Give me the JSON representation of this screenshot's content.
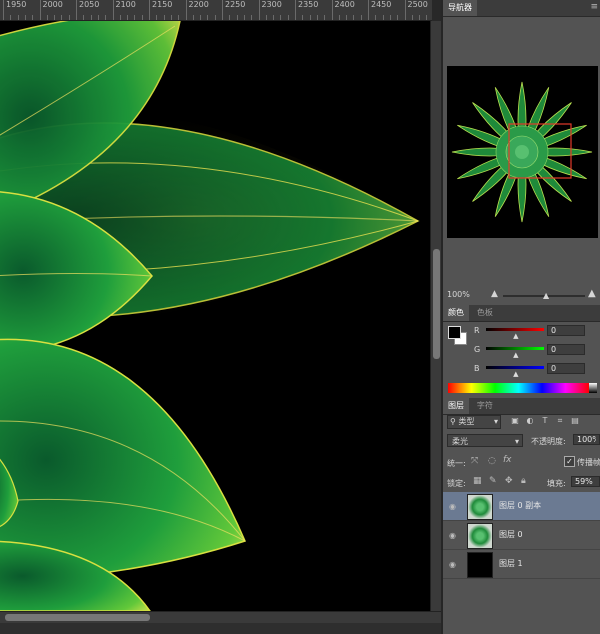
{
  "ruler": {
    "ticks": [
      "1950",
      "2000",
      "2050",
      "2100",
      "2150",
      "2200",
      "2250",
      "2300",
      "2350",
      "2400",
      "2450",
      "2500"
    ]
  },
  "navigator": {
    "tab": "导航器",
    "zoom": "100%"
  },
  "color": {
    "tabs": [
      "颜色",
      "色板"
    ],
    "r_label": "R",
    "g_label": "G",
    "b_label": "B",
    "r_value": "0",
    "g_value": "0",
    "b_value": "0",
    "r_level": 0.52,
    "g_level": 0.52,
    "b_level": 0.52
  },
  "layers": {
    "tabs": [
      "图层",
      "字符"
    ],
    "filter_label": "类型",
    "blend_mode": "柔光",
    "opacity_label": "不透明度:",
    "opacity_value": "100%",
    "unify_label": "统一:",
    "propagate_label": "传播帧",
    "lock_label": "锁定:",
    "fill_label": "填充:",
    "fill_value": "59%",
    "items": [
      {
        "name": "图层 0 副本",
        "selected": true
      },
      {
        "name": "图层 0",
        "selected": false
      },
      {
        "name": "图层 1",
        "selected": false
      }
    ]
  }
}
